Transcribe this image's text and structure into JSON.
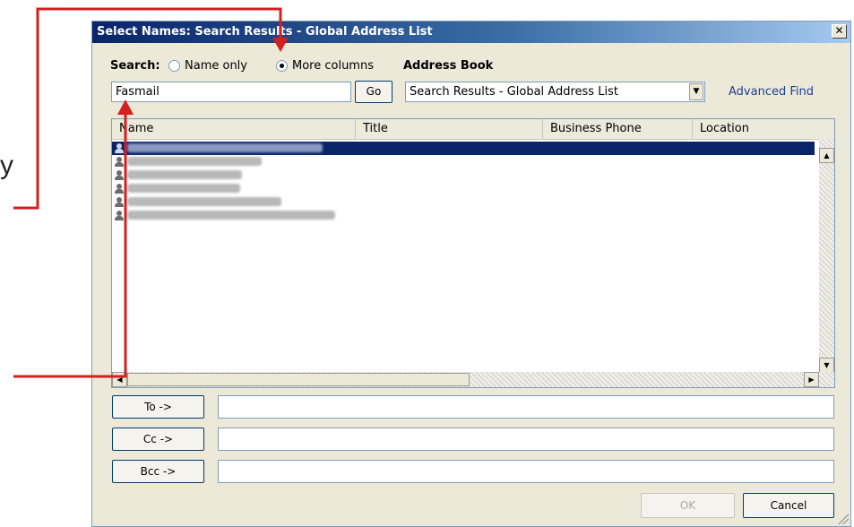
{
  "slide": {
    "partial_letter": "y"
  },
  "dialog": {
    "title": "Select Names: Search Results - Global Address List",
    "close_glyph": "✕",
    "search": {
      "label": "Search:",
      "options": [
        "Name only",
        "More columns"
      ],
      "selected": "More columns",
      "input_value": "Fasmail",
      "go_label": "Go"
    },
    "address_book": {
      "label": "Address Book",
      "selected": "Search Results - Global Address List",
      "advanced_find_label": "Advanced Find"
    },
    "columns": [
      "Name",
      "Title",
      "Business Phone",
      "Location"
    ],
    "results": [
      {
        "selected": true,
        "icon": "contact-icon"
      },
      {
        "selected": false,
        "icon": "contact-icon"
      },
      {
        "selected": false,
        "icon": "contact-icon"
      },
      {
        "selected": false,
        "icon": "contact-icon"
      },
      {
        "selected": false,
        "icon": "contact-icon"
      },
      {
        "selected": false,
        "icon": "contact-icon"
      }
    ],
    "recipients": [
      {
        "label": "To ->",
        "value": ""
      },
      {
        "label": "Cc ->",
        "value": ""
      },
      {
        "label": "Bcc ->",
        "value": ""
      }
    ],
    "ok_label": "OK",
    "cancel_label": "Cancel"
  },
  "colors": {
    "callout": "#d42020",
    "title_start": "#0a246a",
    "title_end": "#a6caf0",
    "selection": "#0a246a"
  }
}
